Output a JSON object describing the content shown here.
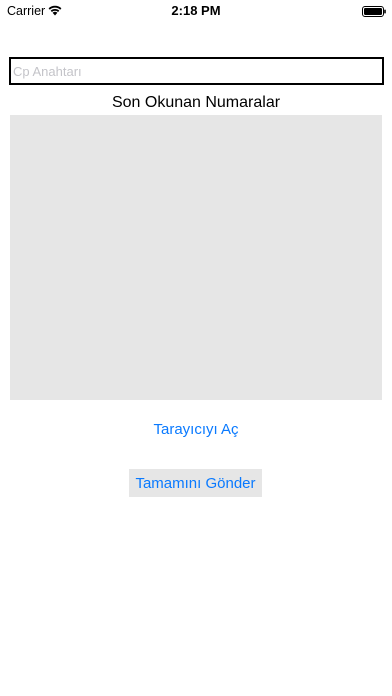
{
  "status_bar": {
    "carrier": "Carrier",
    "time": "2:18 PM",
    "wifi_icon": "wifi-icon",
    "battery_icon": "battery-icon"
  },
  "form": {
    "cp_key_placeholder": "Cp Anahtarı",
    "cp_key_value": ""
  },
  "recent_numbers": {
    "title": "Son Okunan Numaralar",
    "items": []
  },
  "actions": {
    "open_scanner_label": "Tarayıcıyı Aç",
    "send_all_label": "Tamamını Gönder"
  },
  "colors": {
    "accent": "#0a7aff",
    "list_background": "#e6e6e6",
    "placeholder": "#c4c4c9"
  }
}
